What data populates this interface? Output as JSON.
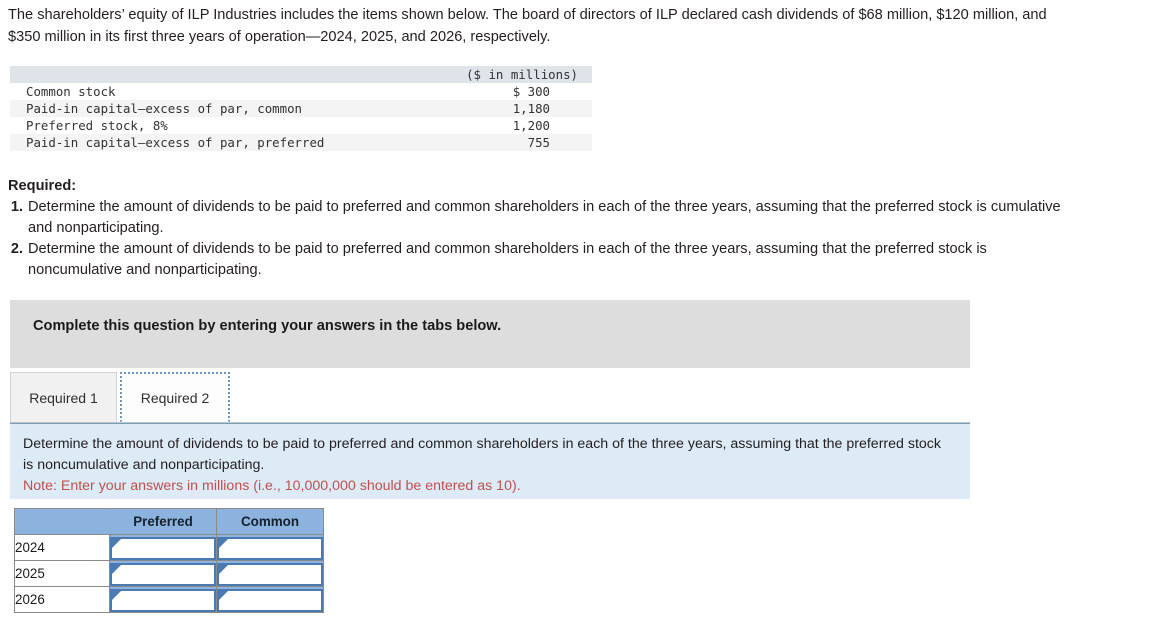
{
  "intro": {
    "paragraph": "The shareholders’ equity of ILP Industries includes the items shown below. The board of directors of ILP declared cash dividends of $68 million, $120 million, and $350 million in its first three years of operation—2024, 2025, and 2026, respectively."
  },
  "equity_table": {
    "header_label": "",
    "header_value": "($ in millions)",
    "rows": [
      {
        "label": "Common stock",
        "value": "$ 300"
      },
      {
        "label": "Paid-in capital—excess of par, common",
        "value": "1,180"
      },
      {
        "label": "Preferred stock, 8%",
        "value": "1,200"
      },
      {
        "label": "Paid-in capital—excess of par, preferred",
        "value": "755"
      }
    ]
  },
  "required": {
    "title": "Required:",
    "items": [
      {
        "num": "1.",
        "text": "Determine the amount of dividends to be paid to preferred and common shareholders in each of the three years, assuming that the preferred stock is cumulative and nonparticipating."
      },
      {
        "num": "2.",
        "text": "Determine the amount of dividends to be paid to preferred and common shareholders in each of the three years, assuming that the preferred stock is noncumulative and nonparticipating."
      }
    ]
  },
  "banner": {
    "text": "Complete this question by entering your answers in the tabs below."
  },
  "tabs": [
    {
      "label": "Required 1",
      "active": false
    },
    {
      "label": "Required 2",
      "active": true
    }
  ],
  "instruction": {
    "body": "Determine the amount of dividends to be paid to preferred and common shareholders in each of the three years, assuming that the preferred stock is noncumulative and nonparticipating.",
    "note": "Note: Enter your answers in millions (i.e., 10,000,000 should be entered as 10)."
  },
  "answer_grid": {
    "columns": [
      "",
      "Preferred",
      "Common"
    ],
    "rows": [
      {
        "year": "2024",
        "preferred": "",
        "common": "",
        "preferred_placeholder": "",
        "common_placeholder": ""
      },
      {
        "year": "2025",
        "preferred": "",
        "common": "",
        "preferred_placeholder": "",
        "common_placeholder": ""
      },
      {
        "year": "2026",
        "preferred": "",
        "common": "",
        "preferred_placeholder": "",
        "common_placeholder": ""
      }
    ]
  },
  "colors": {
    "banner_grey": "#dddddd",
    "instruction_blue": "#ddebf7",
    "note_red": "#c0504d",
    "grid_header_blue": "#8cb3de",
    "input_border_blue": "#4a7ab0",
    "table_header_grey": "#dfe3ea"
  }
}
